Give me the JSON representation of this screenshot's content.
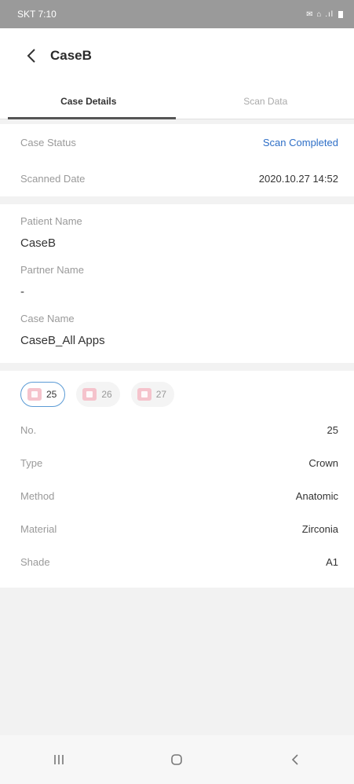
{
  "status_bar": {
    "time": "SKT 7:10",
    "icons": "✉ ⌂ .ıl"
  },
  "header": {
    "title": "CaseB"
  },
  "tabs": [
    {
      "label": "Case Details",
      "active": true
    },
    {
      "label": "Scan Data",
      "active": false
    }
  ],
  "status_section": {
    "case_status_label": "Case Status",
    "case_status_value": "Scan Completed",
    "scanned_date_label": "Scanned Date",
    "scanned_date_value": "2020.10.27 14:52"
  },
  "patient_section": {
    "patient_name_label": "Patient Name",
    "patient_name_value": "CaseB",
    "partner_name_label": "Partner Name",
    "partner_name_value": "-",
    "case_name_label": "Case Name",
    "case_name_value": "CaseB_All Apps"
  },
  "teeth": [
    {
      "number": "25",
      "selected": true
    },
    {
      "number": "26",
      "selected": false
    },
    {
      "number": "27",
      "selected": false
    }
  ],
  "tooth_details": {
    "no_label": "No.",
    "no_value": "25",
    "type_label": "Type",
    "type_value": "Crown",
    "method_label": "Method",
    "method_value": "Anatomic",
    "material_label": "Material",
    "material_value": "Zirconia",
    "shade_label": "Shade",
    "shade_value": "A1"
  },
  "colors": {
    "accent": "#2e6fc7",
    "selected_border": "#5b9bd5",
    "tooth": "#f5c3cc"
  },
  "icons": {
    "back": "chevron-left-icon",
    "nav_recent": "recent-apps-icon",
    "nav_home": "home-icon",
    "nav_back": "back-icon"
  }
}
